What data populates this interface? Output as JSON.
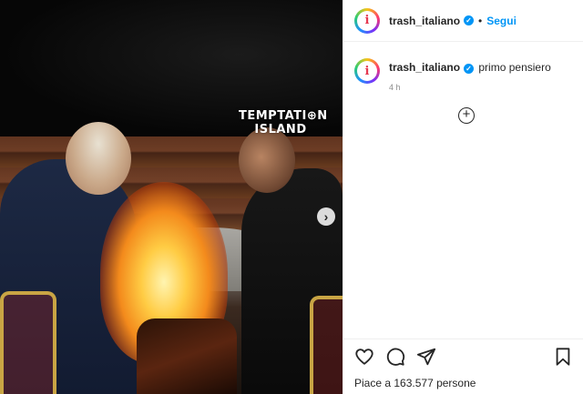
{
  "media": {
    "watermark_line1": "TEMPTATI⊕N",
    "watermark_line2": "ISLAND",
    "next_label": "›"
  },
  "header": {
    "avatar_glyph": "i",
    "username": "trash_italiano",
    "verified_glyph": "✓",
    "separator": "•",
    "follow_label": "Segui"
  },
  "caption": {
    "avatar_glyph": "i",
    "username": "trash_italiano",
    "verified_glyph": "✓",
    "text": "primo pensiero",
    "time": "4 h"
  },
  "comments": {
    "add_icon": "+"
  },
  "actions": {
    "icons": [
      "heart-icon",
      "comment-icon",
      "share-icon",
      "bookmark-icon"
    ],
    "likes_text": "Piace a 163.577 persone"
  },
  "colors": {
    "accent": "#0095f6",
    "text": "#262626",
    "muted": "#8e8e8e",
    "border": "#efefef"
  }
}
